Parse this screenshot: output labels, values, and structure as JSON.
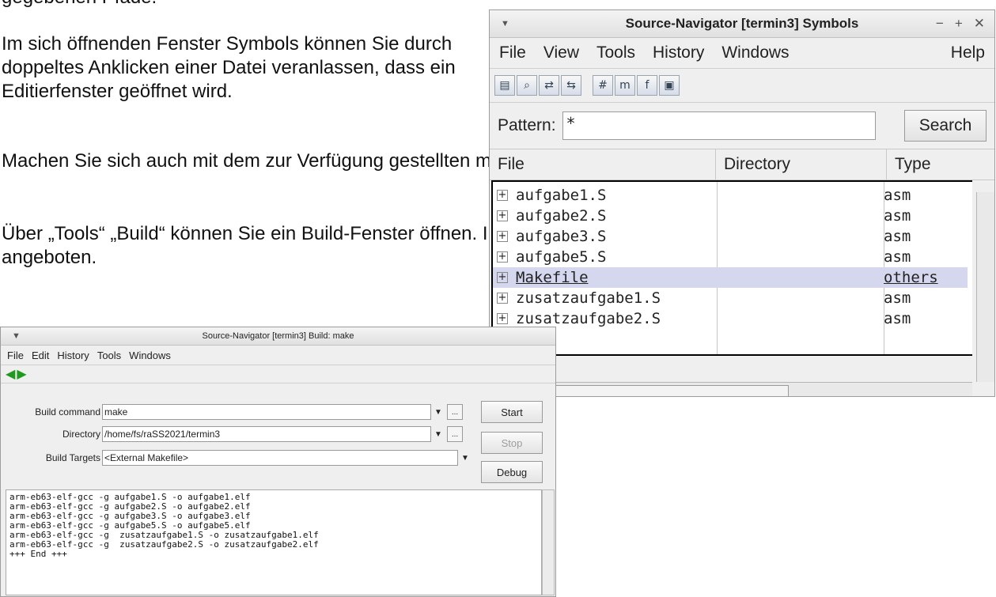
{
  "document": {
    "cut_line": "gegebenen Pfade.",
    "p1": "Im sich öffnenden Fenster Symbols können Sie durch doppeltes Anklicken einer Datei veranlassen, dass ein Editierfenster geöffnet wird.",
    "p2": "Machen Sie sich auch mit dem zur Verfügung gestellten makefile vertraut.",
    "p3": "Über „Tools“ „Build“ können Sie ein Build-Fenster öffnen. In diesem Fenster wird „make“ als Build command angeboten."
  },
  "symbols_window": {
    "title": "Source-Navigator [termin3] Symbols",
    "menu": [
      "File",
      "View",
      "Tools",
      "History",
      "Windows"
    ],
    "help": "Help",
    "pattern_label": "Pattern:",
    "pattern_value": "*",
    "search_label": "Search",
    "columns": [
      "File",
      "Directory",
      "Type"
    ],
    "rows": [
      {
        "file": "aufgabe1.S",
        "type": "asm"
      },
      {
        "file": "aufgabe2.S",
        "type": "asm"
      },
      {
        "file": "aufgabe3.S",
        "type": "asm"
      },
      {
        "file": "aufgabe5.S",
        "type": "asm"
      },
      {
        "file": "Makefile",
        "type": "others",
        "selected": true
      },
      {
        "file": "zusatzaufgabe1.S",
        "type": "asm"
      },
      {
        "file": "zusatzaufgabe2.S",
        "type": "asm"
      }
    ]
  },
  "build_window": {
    "title": "Source-Navigator [termin3] Build: make",
    "menu": [
      "File",
      "Edit",
      "History",
      "Tools",
      "Windows"
    ],
    "build_command_label": "Build command",
    "build_command_value": "make",
    "directory_label": "Directory",
    "directory_value": "/home/fs/raSS2021/termin3",
    "targets_label": "Build Targets",
    "targets_value": "<External Makefile>",
    "start_label": "Start",
    "stop_label": "Stop",
    "debug_label": "Debug",
    "output_lines": [
      "arm-eb63-elf-gcc -g aufgabe1.S -o aufgabe1.elf",
      "arm-eb63-elf-gcc -g aufgabe2.S -o aufgabe2.elf",
      "arm-eb63-elf-gcc -g aufgabe3.S -o aufgabe3.elf",
      "arm-eb63-elf-gcc -g aufgabe5.S -o aufgabe5.elf",
      "arm-eb63-elf-gcc -g  zusatzaufgabe1.S -o zusatzaufgabe1.elf",
      "arm-eb63-elf-gcc -g  zusatzaufgabe2.S -o zusatzaufgabe2.elf",
      "+++ End +++"
    ]
  }
}
